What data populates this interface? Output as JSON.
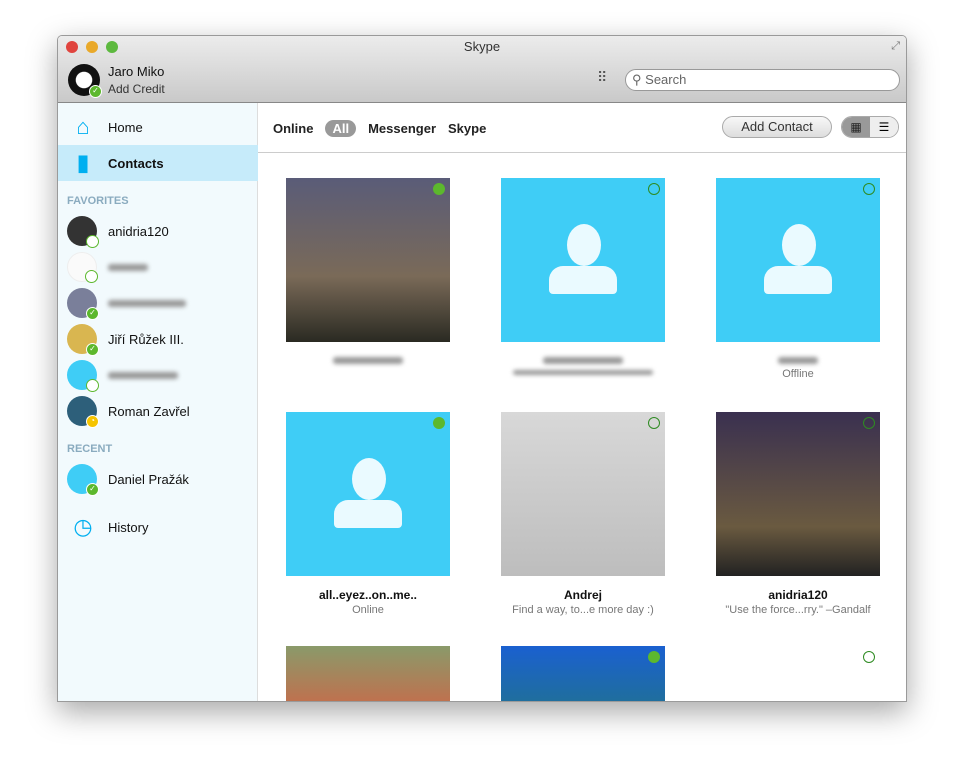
{
  "window": {
    "title": "Skype"
  },
  "profile": {
    "name": "Jaro Miko",
    "credit": "Add Credit"
  },
  "search": {
    "placeholder": "Search"
  },
  "sidebar": {
    "nav": [
      {
        "label": "Home"
      },
      {
        "label": "Contacts"
      }
    ],
    "favorites_label": "FAVORITES",
    "favorites": [
      {
        "name": "anidria120",
        "status": "offline"
      },
      {
        "name": "",
        "status": "offline"
      },
      {
        "name": "",
        "status": "online"
      },
      {
        "name": "Jiří Růžek III.",
        "status": "online"
      },
      {
        "name": "",
        "status": "offline"
      },
      {
        "name": "Roman Zavřel",
        "status": "away"
      }
    ],
    "recent_label": "RECENT",
    "recent": [
      {
        "name": "Daniel Pražák",
        "status": "online"
      }
    ],
    "history": "History"
  },
  "filters": {
    "online": "Online",
    "all": "All",
    "messenger": "Messenger",
    "skype": "Skype"
  },
  "toolbar": {
    "add_contact": "Add Contact"
  },
  "tiles": [
    {
      "name": "",
      "status_text": ""
    },
    {
      "name": "",
      "status_text": ""
    },
    {
      "name": "",
      "status_text": "Offline"
    },
    {
      "name": "all..eyez..on..me..",
      "status_text": "Online"
    },
    {
      "name": "Andrej",
      "status_text": "Find a way, to...e more day :)"
    },
    {
      "name": "anidria120",
      "status_text": "\"Use the force...rry.\" –Gandalf"
    }
  ],
  "colors": {
    "accent": "#00aff0",
    "online": "#5cb82d",
    "away": "#f5c400",
    "placeholder_tile": "#3fcdf6"
  }
}
